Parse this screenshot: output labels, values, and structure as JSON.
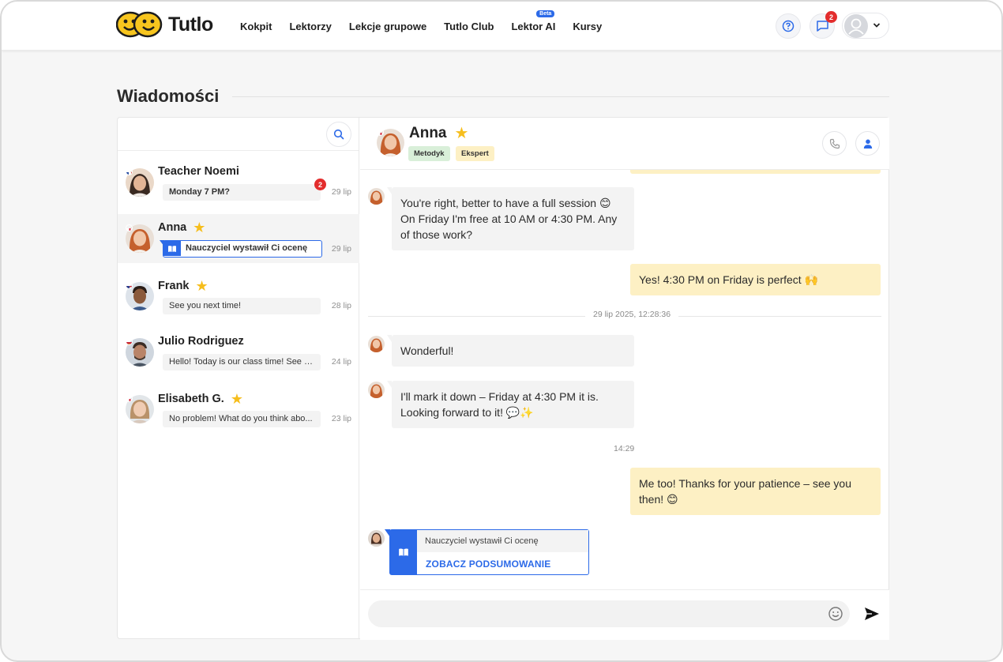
{
  "brand": {
    "name": "Tutlo"
  },
  "nav": {
    "items": [
      {
        "label": "Kokpit"
      },
      {
        "label": "Lektorzy"
      },
      {
        "label": "Lekcje grupowe"
      },
      {
        "label": "Tutlo Club"
      },
      {
        "label": "Lektor AI",
        "badge": "Beta"
      },
      {
        "label": "Kursy"
      }
    ]
  },
  "header": {
    "messages_badge": "2"
  },
  "page": {
    "title": "Wiadomości"
  },
  "conversations": [
    {
      "name": "Teacher Noemi",
      "preview": "Monday 7 PM?",
      "date": "29 lip",
      "unread": "2",
      "starred": false
    },
    {
      "name": "Anna",
      "preview": "Nauczyciel wystawił Ci ocenę",
      "date": "29 lip",
      "starred": true,
      "active": true
    },
    {
      "name": "Frank",
      "preview": "See you next time!",
      "date": "28 lip",
      "starred": true
    },
    {
      "name": "Julio Rodriguez",
      "preview": "Hello! Today is our class time! See y...",
      "date": "24 lip",
      "starred": false
    },
    {
      "name": "Elisabeth G.",
      "preview": "No problem! What do you think abo...",
      "date": "23 lip",
      "starred": true
    }
  ],
  "chat": {
    "name": "Anna",
    "tags": [
      {
        "label": "Metodyk",
        "color": "#d9efd9"
      },
      {
        "label": "Ekspert",
        "color": "#fdf0c4"
      }
    ],
    "messages": [
      {
        "text": "You're right, better to have a full session 😊 On Friday I'm free at 10 AM or 4:30 PM. Any of those work?"
      },
      {
        "text": "Yes! 4:30 PM on Friday is perfect 🙌"
      },
      {
        "text": "Wonderful!"
      },
      {
        "text": "I'll mark it down – Friday at 4:30 PM it is. Looking forward to it! 💬✨"
      },
      {
        "text": "Me too! Thanks for your patience – see you then! 😊"
      }
    ],
    "date_divider": "29 lip 2025, 12:28:36",
    "time_label": "14:29",
    "rating_card": {
      "title": "Nauczyciel wystawił Ci ocenę",
      "link": "ZOBACZ PODSUMOWANIE"
    }
  },
  "colors": {
    "accent": "#2c6ae8",
    "outgoing": "#fdf0c4",
    "incoming": "#f3f3f3",
    "star": "#f6be1d",
    "badge": "#e32d2d"
  }
}
